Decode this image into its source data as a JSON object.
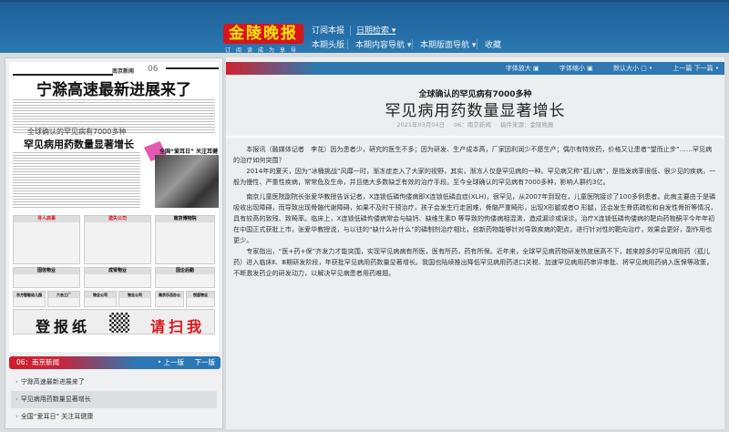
{
  "header": {
    "logo": "金陵晚报",
    "logo_sub": "订阅读成为享导",
    "nav": {
      "subscribe": "订阅本报",
      "date_search": "日期检索",
      "headline": "本期头版",
      "content_nav": "本期内容导航",
      "page_nav": "本期版面导航",
      "favorite": "收藏"
    }
  },
  "paper": {
    "section": "南京新闻",
    "page_no": "06",
    "headline": "宁滁高速最新进展来了",
    "sub": "全球确认的罕见病有7000多种",
    "headline2": "罕见病用药数量显著增长",
    "side_head": "全国“爱耳日” 关注耳健康",
    "ads": [
      "寻人启事",
      "遗失公司",
      "南京博物院",
      "国信物业",
      "成贤物业",
      "国企后勤",
      "东方智能幼儿园",
      "六合工厂",
      "物业公司",
      "物业公司",
      "南京乐活办公",
      "悦居物业"
    ],
    "banner_left": "登报纸",
    "banner_right": "请扫我"
  },
  "pagebar": {
    "label": "06：南京新闻",
    "prev": "上一版",
    "next": "下一版"
  },
  "article_list": [
    "宁滁高速最新进展来了",
    "罕见病用药数量显著增长",
    "全国“爱耳日” 关注耳健康"
  ],
  "toolbar": {
    "font_up": "字体放大",
    "font_down": "字体缩小",
    "default_size": "默认大小",
    "prev_next": "上一篇 下一篇"
  },
  "article": {
    "kicker": "全球确认的罕见病有7000多种",
    "title": "罕见病用药数量显著增长",
    "date": "2021年03月04日",
    "page": "06：南京新闻",
    "source": "稿件来源：金陵晚报",
    "paragraphs": [
      "本报讯（融媒体记者　李花）因为患者少，研究的医生不多；因为研发、生产成本高，厂家因利润少不愿生产；偶尔有特效药，价格又让患者“望而止步”……罕见病的治疗如何突围？",
      "2014年的夏天，因为“冰桶挑战”风靡一时，渐冻症走入了大家的视野，其实，渐冻人仅是罕见病的一种。罕见病又称“孤儿病”，是指发病率很低、很少见的疾病，一般为慢性、严重性疾病，常常危及生命，并且绝大多数缺乏有效的治疗手段。至今全球确认的罕见病有7000多种，影响人群约3亿。",
      "南京儿童医院副院长张爱华教授告诉记者，X连锁低磷佝偻病即X连锁低磷血症(XLH)，很罕见，从2007年到现在，儿童医院接诊了100多例患者。此病主要由于是磷吸收出现障碍，而导致出现骨骼代谢障碍，如果不及时干预治疗，孩子会发生行走困难，骨骼严重畸形，出现X形腿或者O 形腿，还会发生骨质疏松和自发性骨折等情况，具有较高的致残、致畸率。临床上，X连锁低磷佝偻病常会与缺钙、缺维生素D 等导致的佝偻病相混淆，造成漏诊或误诊。治疗X连锁低磷佝偻病的靶向药物酮平今年年初在中国正式获批上市，张爱华教授说，与以往的“缺什么补什么”的磷制剂治疗相比，创新药物能够针对导致疾病的靶点，进行针对性的靶向治疗，效果会更好，副作用也更少。",
      "专家指出，“医+药+保”齐发力才能突围，实现罕见病病有所医，医有所药，药有所保。近年来，全球罕见病药物研发热度居高不下，越来越多的罕见病用药（孤儿药）进入临床Ⅱ、Ⅲ期研发阶段，年获批罕见病用药数量显著增长。我国也陆续推出降低罕见病用药进口关税、加速罕见病用药审评审批、将罕见病用药纳入医保等政策，不断激发药企的研发动力，以解决罕见病患者用药难题。"
    ]
  }
}
